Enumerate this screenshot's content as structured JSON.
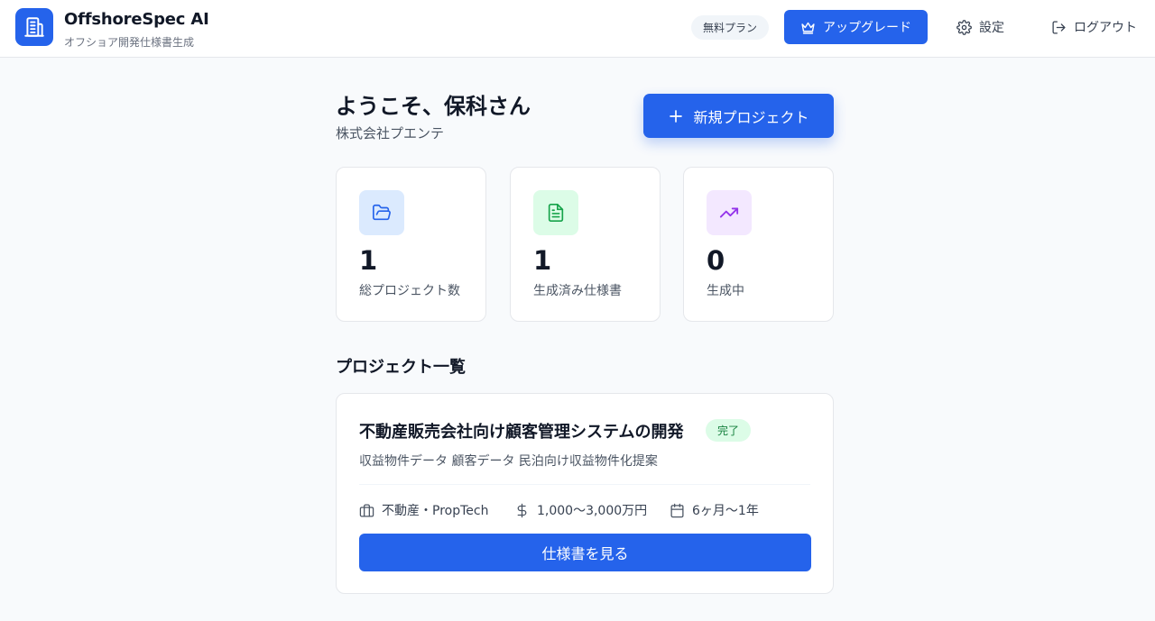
{
  "header": {
    "brand_title": "OffshoreSpec AI",
    "brand_subtitle": "オフショア開発仕様書生成",
    "plan_badge": "無料プラン",
    "upgrade_label": "アップグレード",
    "settings_label": "設定",
    "logout_label": "ログアウト"
  },
  "welcome": {
    "title": "ようこそ、保科さん",
    "company": "株式会社プエンテ",
    "new_project_label": "新規プロジェクト"
  },
  "stats": [
    {
      "value": "1",
      "label": "総プロジェクト数",
      "icon": "folder-open-icon",
      "color": "#2563eb",
      "bg": "#dbeafe"
    },
    {
      "value": "1",
      "label": "生成済み仕様書",
      "icon": "file-text-icon",
      "color": "#16a34a",
      "bg": "#dcfce7"
    },
    {
      "value": "0",
      "label": "生成中",
      "icon": "trending-up-icon",
      "color": "#9333ea",
      "bg": "#f3e8ff"
    }
  ],
  "projects_section": {
    "title": "プロジェクト一覧",
    "items": [
      {
        "title": "不動産販売会社向け顧客管理システムの開発",
        "status": "完了",
        "tags": "収益物件データ 顧客データ 民泊向け収益物件化提案",
        "industry": "不動産・PropTech",
        "budget": "1,000〜3,000万円",
        "period": "6ヶ月〜1年",
        "view_label": "仕様書を見る"
      }
    ]
  },
  "colors": {
    "primary": "#2563eb",
    "success_bg": "#dcfce7",
    "success_text": "#15803d"
  }
}
